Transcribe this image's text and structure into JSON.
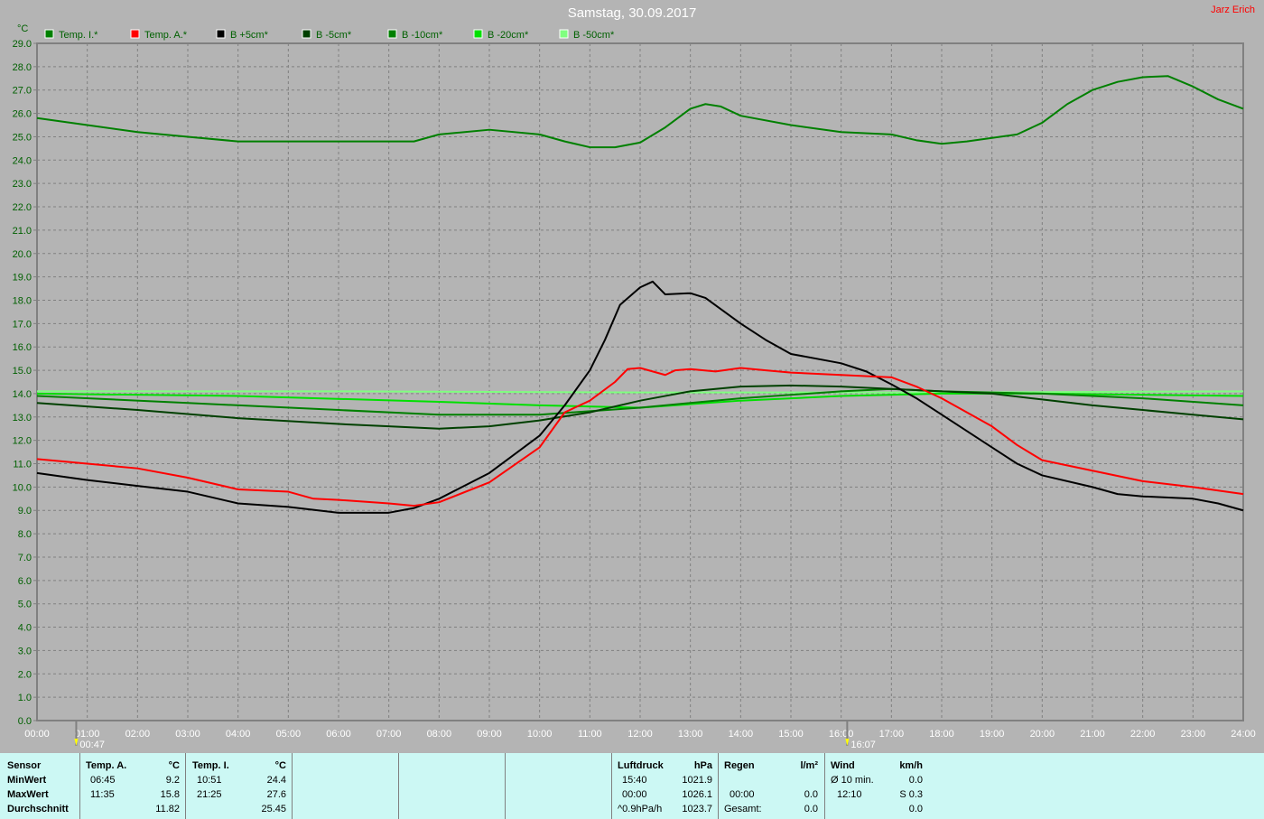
{
  "chart_data": {
    "type": "line",
    "title": "Samstag, 30.09.2017",
    "author": "Jarz Erich",
    "ylabel": "°C",
    "ylim": [
      0,
      29
    ],
    "xlim": [
      0,
      24
    ],
    "grid": true,
    "legend": "top-left",
    "yticks": [
      "0.0",
      "1.0",
      "2.0",
      "3.0",
      "4.0",
      "5.0",
      "6.0",
      "7.0",
      "8.0",
      "9.0",
      "10.0",
      "11.0",
      "12.0",
      "13.0",
      "14.0",
      "15.0",
      "16.0",
      "17.0",
      "18.0",
      "19.0",
      "20.0",
      "21.0",
      "22.0",
      "23.0",
      "24.0",
      "25.0",
      "26.0",
      "27.0",
      "28.0",
      "29.0"
    ],
    "xticks": [
      "00:00",
      "01:00",
      "02:00",
      "03:00",
      "04:00",
      "05:00",
      "06:00",
      "07:00",
      "08:00",
      "09:00",
      "10:00",
      "11:00",
      "12:00",
      "13:00",
      "14:00",
      "15:00",
      "16:00",
      "17:00",
      "18:00",
      "19:00",
      "20:00",
      "21:00",
      "22:00",
      "23:00",
      "24:00"
    ],
    "markers": [
      {
        "label": "00:47",
        "x": 0.78
      },
      {
        "label": "16:07",
        "x": 16.12
      }
    ],
    "series": [
      {
        "name": "Temp. I.*",
        "color": "#008000",
        "points": [
          [
            0,
            25.8
          ],
          [
            1,
            25.5
          ],
          [
            2,
            25.2
          ],
          [
            3,
            25.0
          ],
          [
            4,
            24.8
          ],
          [
            5,
            24.8
          ],
          [
            6,
            24.8
          ],
          [
            7,
            24.8
          ],
          [
            7.5,
            24.8
          ],
          [
            8,
            25.1
          ],
          [
            9,
            25.3
          ],
          [
            10,
            25.1
          ],
          [
            10.5,
            24.8
          ],
          [
            11,
            24.55
          ],
          [
            11.5,
            24.55
          ],
          [
            12,
            24.75
          ],
          [
            12.5,
            25.4
          ],
          [
            13,
            26.2
          ],
          [
            13.3,
            26.4
          ],
          [
            13.6,
            26.3
          ],
          [
            14,
            25.9
          ],
          [
            15,
            25.5
          ],
          [
            16,
            25.2
          ],
          [
            17,
            25.1
          ],
          [
            17.5,
            24.85
          ],
          [
            18,
            24.7
          ],
          [
            18.5,
            24.8
          ],
          [
            19,
            24.95
          ],
          [
            19.5,
            25.1
          ],
          [
            20,
            25.6
          ],
          [
            20.5,
            26.4
          ],
          [
            21,
            27.0
          ],
          [
            21.5,
            27.35
          ],
          [
            22,
            27.55
          ],
          [
            22.5,
            27.6
          ],
          [
            23,
            27.15
          ],
          [
            23.5,
            26.6
          ],
          [
            24,
            26.2
          ]
        ]
      },
      {
        "name": "Temp. A.*",
        "color": "#ff0000",
        "points": [
          [
            0,
            11.2
          ],
          [
            1,
            11.0
          ],
          [
            2,
            10.8
          ],
          [
            3,
            10.4
          ],
          [
            4,
            9.9
          ],
          [
            5,
            9.8
          ],
          [
            5.5,
            9.5
          ],
          [
            6,
            9.45
          ],
          [
            7,
            9.3
          ],
          [
            7.5,
            9.2
          ],
          [
            8,
            9.35
          ],
          [
            9,
            10.2
          ],
          [
            10,
            11.7
          ],
          [
            10.5,
            13.2
          ],
          [
            11,
            13.7
          ],
          [
            11.5,
            14.5
          ],
          [
            11.75,
            15.05
          ],
          [
            12,
            15.1
          ],
          [
            12.5,
            14.8
          ],
          [
            12.7,
            15.0
          ],
          [
            13,
            15.05
          ],
          [
            13.5,
            14.95
          ],
          [
            14,
            15.1
          ],
          [
            14.5,
            15.0
          ],
          [
            15,
            14.9
          ],
          [
            16,
            14.8
          ],
          [
            17,
            14.7
          ],
          [
            17.5,
            14.3
          ],
          [
            18,
            13.8
          ],
          [
            19,
            12.6
          ],
          [
            19.5,
            11.8
          ],
          [
            20,
            11.15
          ],
          [
            21,
            10.7
          ],
          [
            22,
            10.25
          ],
          [
            23,
            10.0
          ],
          [
            24,
            9.7
          ]
        ]
      },
      {
        "name": "B +5cm*",
        "color": "#000000",
        "points": [
          [
            0,
            10.6
          ],
          [
            1,
            10.3
          ],
          [
            2,
            10.05
          ],
          [
            3,
            9.8
          ],
          [
            4,
            9.3
          ],
          [
            5,
            9.15
          ],
          [
            6,
            8.9
          ],
          [
            7,
            8.9
          ],
          [
            7.5,
            9.1
          ],
          [
            8,
            9.5
          ],
          [
            9,
            10.6
          ],
          [
            10,
            12.2
          ],
          [
            10.5,
            13.5
          ],
          [
            11,
            15.0
          ],
          [
            11.3,
            16.3
          ],
          [
            11.6,
            17.8
          ],
          [
            12,
            18.55
          ],
          [
            12.25,
            18.8
          ],
          [
            12.5,
            18.25
          ],
          [
            13,
            18.3
          ],
          [
            13.3,
            18.1
          ],
          [
            14,
            17.0
          ],
          [
            14.5,
            16.3
          ],
          [
            15,
            15.7
          ],
          [
            16,
            15.3
          ],
          [
            16.5,
            14.95
          ],
          [
            17,
            14.4
          ],
          [
            17.5,
            13.8
          ],
          [
            18,
            13.1
          ],
          [
            19,
            11.7
          ],
          [
            19.5,
            11.0
          ],
          [
            20,
            10.5
          ],
          [
            21,
            10.0
          ],
          [
            21.5,
            9.7
          ],
          [
            22,
            9.6
          ],
          [
            23,
            9.5
          ],
          [
            23.5,
            9.3
          ],
          [
            24,
            9.0
          ]
        ]
      },
      {
        "name": "B -5cm*",
        "color": "#004000",
        "points": [
          [
            0,
            13.6
          ],
          [
            2,
            13.3
          ],
          [
            4,
            12.95
          ],
          [
            6,
            12.7
          ],
          [
            7,
            12.6
          ],
          [
            8,
            12.5
          ],
          [
            9,
            12.6
          ],
          [
            10,
            12.85
          ],
          [
            11,
            13.2
          ],
          [
            12,
            13.7
          ],
          [
            13,
            14.1
          ],
          [
            14,
            14.3
          ],
          [
            15,
            14.35
          ],
          [
            16,
            14.3
          ],
          [
            17,
            14.2
          ],
          [
            18,
            14.1
          ],
          [
            19,
            14.0
          ],
          [
            20,
            13.75
          ],
          [
            21,
            13.5
          ],
          [
            22,
            13.3
          ],
          [
            23,
            13.1
          ],
          [
            24,
            12.9
          ]
        ]
      },
      {
        "name": "B -10cm*",
        "color": "#008000",
        "points": [
          [
            0,
            13.9
          ],
          [
            3,
            13.6
          ],
          [
            6,
            13.3
          ],
          [
            8,
            13.1
          ],
          [
            10,
            13.1
          ],
          [
            12,
            13.4
          ],
          [
            14,
            13.8
          ],
          [
            16,
            14.1
          ],
          [
            17,
            14.2
          ],
          [
            18,
            14.1
          ],
          [
            20,
            14.0
          ],
          [
            22,
            13.8
          ],
          [
            24,
            13.5
          ]
        ]
      },
      {
        "name": "B -20cm*",
        "color": "#00e000",
        "points": [
          [
            0,
            14.0
          ],
          [
            4,
            13.9
          ],
          [
            8,
            13.65
          ],
          [
            10,
            13.5
          ],
          [
            12,
            13.4
          ],
          [
            14,
            13.7
          ],
          [
            16,
            13.9
          ],
          [
            18,
            14.0
          ],
          [
            20,
            14.0
          ],
          [
            24,
            13.9
          ]
        ]
      },
      {
        "name": "B -50cm*",
        "color": "#80ff80",
        "points": [
          [
            0,
            14.1
          ],
          [
            6,
            14.1
          ],
          [
            12,
            14.05
          ],
          [
            18,
            14.05
          ],
          [
            24,
            14.1
          ]
        ]
      }
    ]
  },
  "table": {
    "row_labels": [
      "Sensor",
      "MinWert",
      "MaxWert",
      "Durchschnitt"
    ],
    "temp_a": {
      "title": "Temp. A.",
      "unit": "°C",
      "min_time": "06:45",
      "min": "9.2",
      "max_time": "11:35",
      "max": "15.8",
      "avg": "11.82"
    },
    "temp_i": {
      "title": "Temp. I.",
      "unit": "°C",
      "min_time": "10:51",
      "min": "24.4",
      "max_time": "21:25",
      "max": "27.6",
      "avg": "25.45"
    },
    "luftdruck": {
      "title": "Luftdruck",
      "unit": "hPa",
      "r1a": "15:40",
      "r1b": "1021.9",
      "r2a": "00:00",
      "r2b": "1026.1",
      "r3a": "^0.9hPa/h",
      "r3b": "1023.7"
    },
    "regen": {
      "title": "Regen",
      "unit": "l/m²",
      "r2a": "00:00",
      "r2b": "0.0",
      "r3a": "Gesamt:",
      "r3b": "0.0"
    },
    "wind": {
      "title": "Wind",
      "unit": "km/h",
      "r1a": "Ø 10 min.",
      "r1b": "0.0",
      "r2a": "12:10",
      "r2b": "S 0.3",
      "r3b": "0.0"
    }
  }
}
